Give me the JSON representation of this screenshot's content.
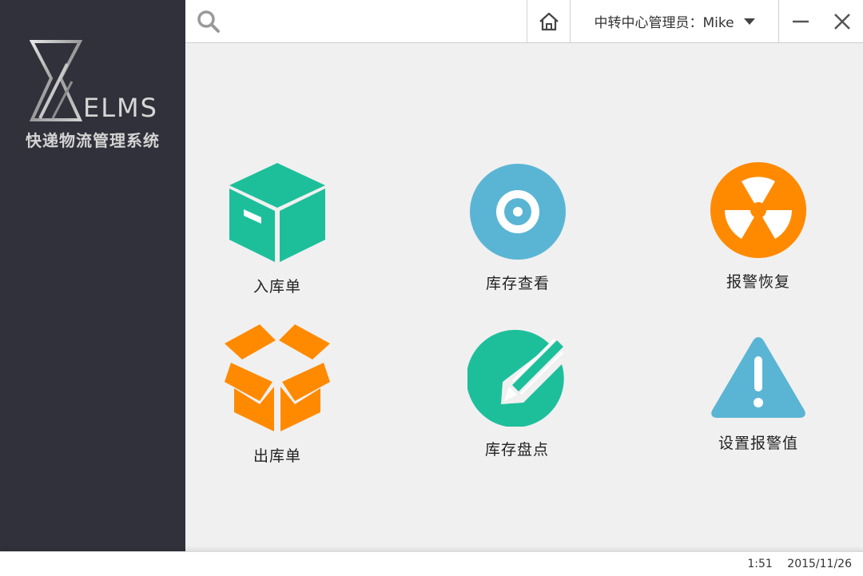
{
  "app": {
    "logo_text": "ELMS",
    "subtitle": "快递物流管理系统"
  },
  "topbar": {
    "search_icon": "search-icon",
    "home_icon": "home-icon",
    "user_label": "中转中心管理员：Mike",
    "minimize_icon": "minimize-icon",
    "close_icon": "close-icon"
  },
  "tiles": [
    {
      "label": "入库单",
      "icon": "box-closed-icon",
      "color": "#1dbf9b"
    },
    {
      "label": "库存查看",
      "icon": "disc-icon",
      "color": "#5ab5d4"
    },
    {
      "label": "报警恢复",
      "icon": "radiation-icon",
      "color": "#ff8a00"
    },
    {
      "label": "出库单",
      "icon": "box-open-icon",
      "color": "#ff8a00"
    },
    {
      "label": "库存盘点",
      "icon": "pencil-circle-icon",
      "color": "#1dbf9b"
    },
    {
      "label": "设置报警值",
      "icon": "warning-icon",
      "color": "#5ab5d4"
    }
  ],
  "status": {
    "time": "1:51",
    "date": "2015/11/26"
  },
  "colors": {
    "sidebar": "#30313a",
    "teal": "#1dbf9b",
    "blue": "#5ab5d4",
    "orange": "#ff8a00"
  }
}
